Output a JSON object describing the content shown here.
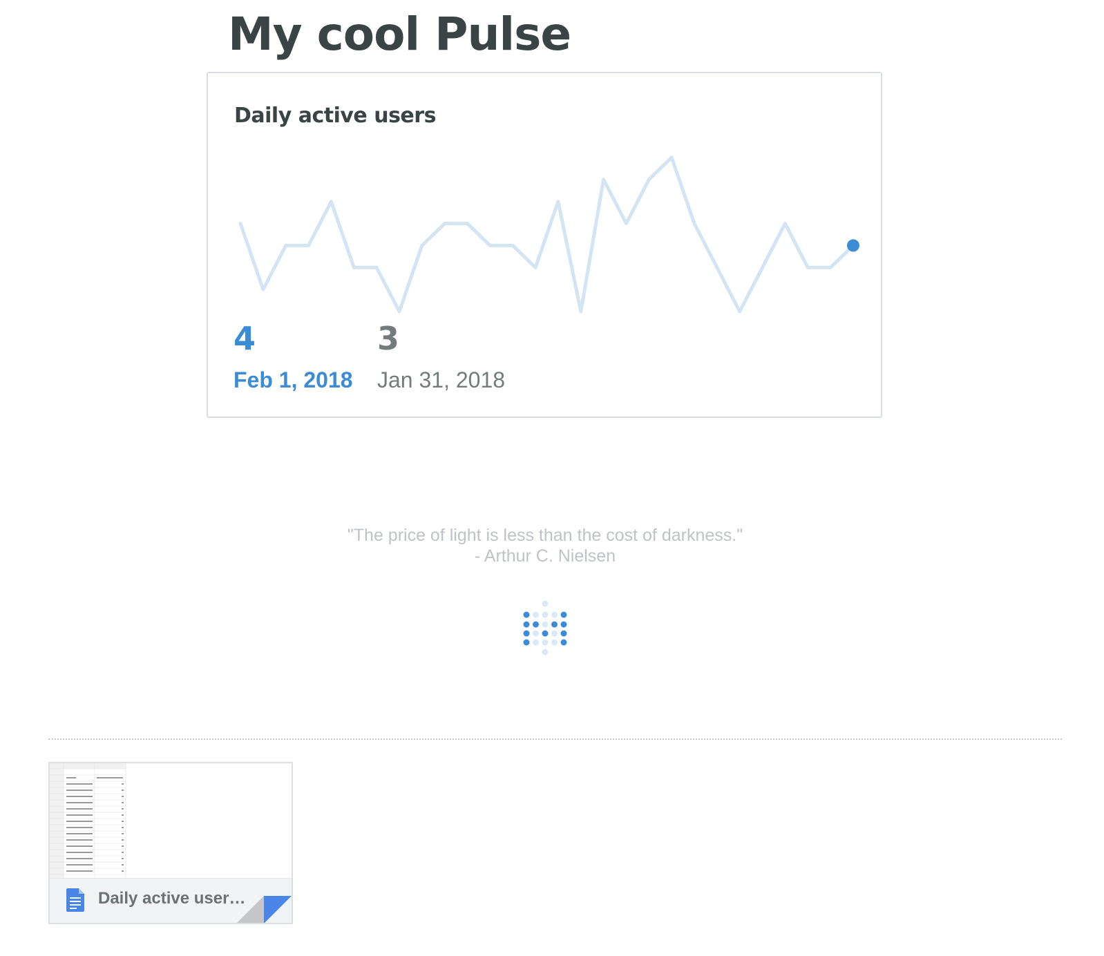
{
  "page": {
    "title": "My cool Pulse"
  },
  "card": {
    "title": "Daily active users",
    "current": {
      "value": "4",
      "date": "Feb 1, 2018"
    },
    "previous": {
      "value": "3",
      "date": "Jan 31, 2018"
    },
    "sparkline": {
      "values": [
        5,
        2,
        4,
        4,
        6,
        3,
        3,
        1,
        4,
        5,
        5,
        4,
        4,
        3,
        6,
        1,
        7,
        5,
        7,
        8,
        5,
        3,
        1,
        3,
        5,
        3,
        3,
        4
      ],
      "min": 0,
      "max": 8
    }
  },
  "quote": {
    "text": "\"The price of light is less than the cost of darkness.\"",
    "author": "- Arthur C. Nielsen"
  },
  "attachment": {
    "name": "Daily active user…",
    "icon": "doc-icon"
  },
  "colors": {
    "accent": "#3b8bd6",
    "sparkline": "#d3e4f3",
    "title": "#3a4444",
    "muted": "#757b7c",
    "quote": "#bfc3c7"
  }
}
